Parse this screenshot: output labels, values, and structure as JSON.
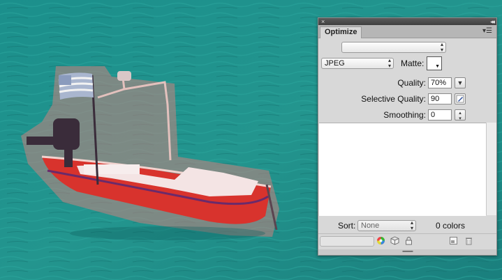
{
  "panel": {
    "title_close": "×",
    "title_collapse": "◂◂",
    "tab_label": "Optimize",
    "menu_icon": "▾☰",
    "preset_value": "",
    "format_value": "JPEG",
    "matte_label": "Matte:",
    "quality_label": "Quality:",
    "quality_value": "70%",
    "selective_quality_label": "Selective Quality:",
    "selective_quality_value": "90",
    "smoothing_label": "Smoothing:",
    "smoothing_value": "0",
    "sort_label": "Sort:",
    "sort_value": "None",
    "colors_count": "0 colors",
    "grip": "▪▪▪▪▪▪▪▪▪▪"
  },
  "icons": {
    "color_wheel": "color-wheel-icon",
    "web_snap": "cube-icon",
    "lock": "lock-icon",
    "new_color": "new-color-icon",
    "trash": "trash-icon",
    "edit": "pencil-icon"
  },
  "colors": {
    "water": "#1f8c87",
    "boat_red": "#d8332d",
    "panel_bg": "#d8d8d8"
  }
}
